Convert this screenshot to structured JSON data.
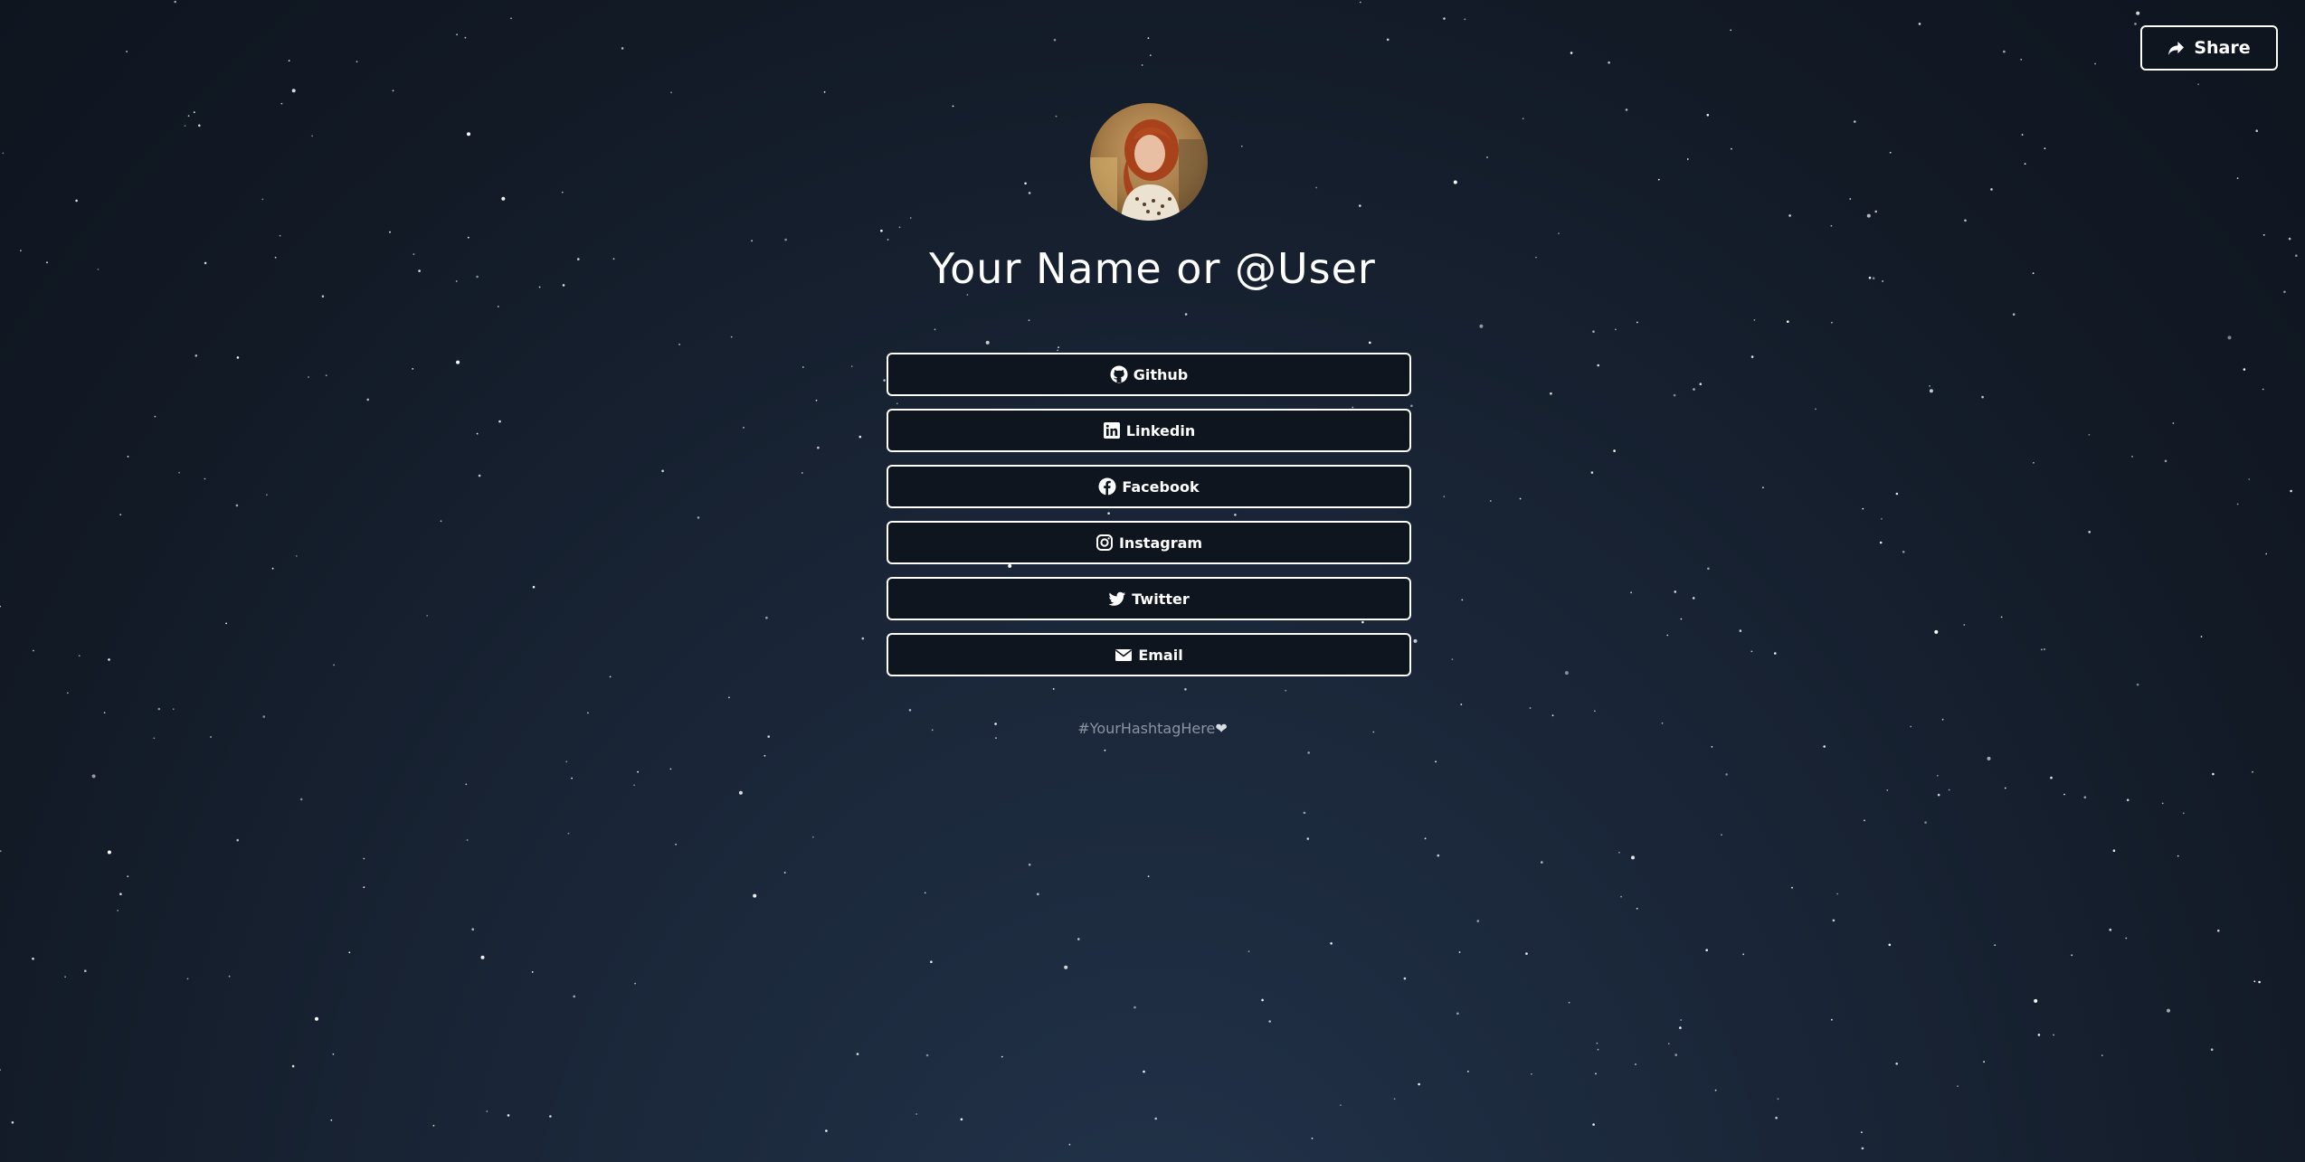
{
  "header": {
    "share_label": "Share",
    "share_icon": "share-arrow-icon"
  },
  "profile": {
    "name": "Your Name or @User",
    "avatar_icon": "avatar-photo"
  },
  "links": [
    {
      "label": "Github",
      "icon": "github-icon"
    },
    {
      "label": "Linkedin",
      "icon": "linkedin-icon"
    },
    {
      "label": "Facebook",
      "icon": "facebook-icon"
    },
    {
      "label": "Instagram",
      "icon": "instagram-icon"
    },
    {
      "label": "Twitter",
      "icon": "twitter-icon"
    },
    {
      "label": "Email",
      "icon": "email-icon"
    }
  ],
  "footer": {
    "hashtag": "#YourHashtagHere",
    "heart": "❤"
  },
  "colors": {
    "background_top": "#0f151f",
    "background_bottom": "#22334a",
    "button_border": "#ffffff",
    "hashtag_text": "#8a94a3"
  }
}
